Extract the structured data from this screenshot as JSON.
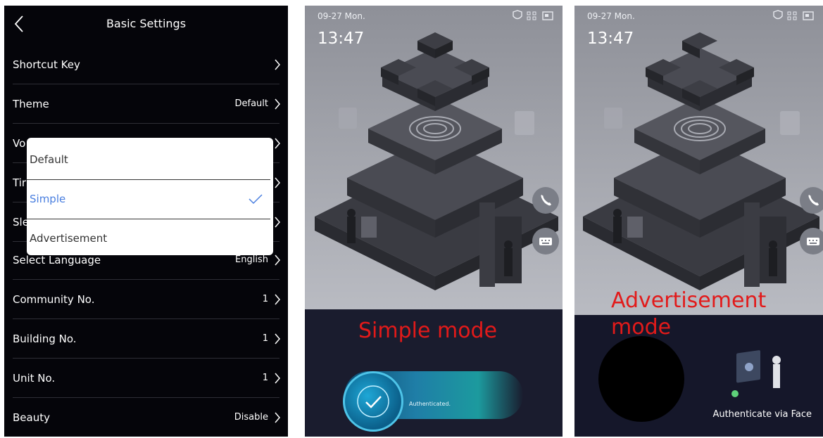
{
  "settings": {
    "title": "Basic Settings",
    "rows": [
      {
        "label": "Shortcut Key",
        "value": ""
      },
      {
        "label": "Theme",
        "value": "Default"
      },
      {
        "label": "Vo",
        "value": ""
      },
      {
        "label": "Tir",
        "value": ""
      },
      {
        "label": "Sle",
        "value": ""
      },
      {
        "label": "Select Language",
        "value": "English"
      },
      {
        "label": "Community No.",
        "value": "1"
      },
      {
        "label": "Building No.",
        "value": "1"
      },
      {
        "label": "Unit No.",
        "value": "1"
      },
      {
        "label": "Beauty",
        "value": "Disable"
      }
    ],
    "theme_popup": {
      "options": [
        "Default",
        "Simple",
        "Advertisement"
      ],
      "selected": "Simple"
    }
  },
  "simple_screen": {
    "date": "09-27 Mon.",
    "time": "13:47",
    "caption": "Simple mode",
    "auth_text": "Authenticated."
  },
  "ad_screen": {
    "date": "09-27 Mon.",
    "time": "13:47",
    "caption_line1": "Advertisement",
    "caption_line2": "mode",
    "face_text": "Authenticate via Face"
  },
  "colors": {
    "settings_bg": "#05050a",
    "selected_option": "#4a7fe0",
    "caption_red": "#e21a1a"
  }
}
